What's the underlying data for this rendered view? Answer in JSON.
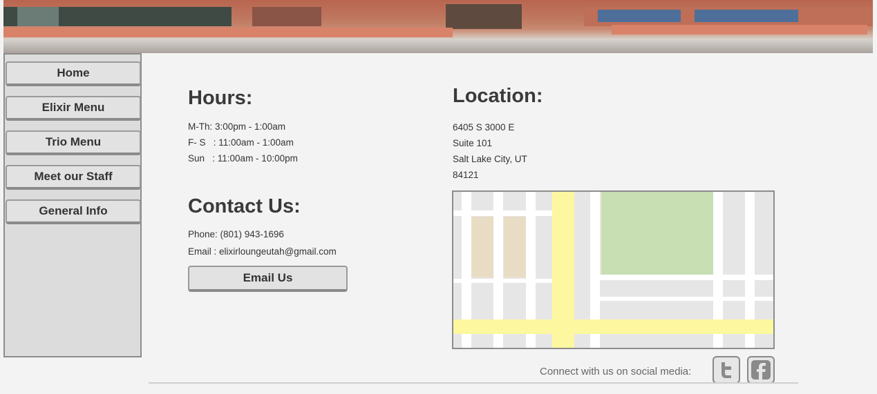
{
  "nav": {
    "items": [
      {
        "label": "Home"
      },
      {
        "label": "Elixir Menu"
      },
      {
        "label": "Trio Menu"
      },
      {
        "label": "Meet our Staff"
      },
      {
        "label": "General Info"
      }
    ]
  },
  "hours": {
    "title": "Hours:",
    "lines": [
      "M-Th: 3:00pm - 1:00am",
      "F- S   : 11:00am - 1:00am",
      "Sun   : 11:00am - 10:00pm"
    ]
  },
  "contact": {
    "title": "Contact Us:",
    "phone": "Phone: (801) 943-1696",
    "email": "Email : elixirloungeutah@gmail.com",
    "button_label": "Email Us"
  },
  "location": {
    "title": "Location:",
    "lines": [
      "6405 S 3000 E",
      "Suite 101",
      "Salt Lake City, UT",
      "84121"
    ]
  },
  "social": {
    "text": "Connect with us on social media:",
    "icons": [
      "twitter-icon",
      "facebook-icon"
    ]
  },
  "colors": {
    "background": "#f3f3f3",
    "sidebar": "#dcdcdc",
    "button": "#e2e2e2",
    "map_park": "#c8dfb4",
    "map_building": "#e8dcc4",
    "map_main_road": "#fdf8a0"
  }
}
